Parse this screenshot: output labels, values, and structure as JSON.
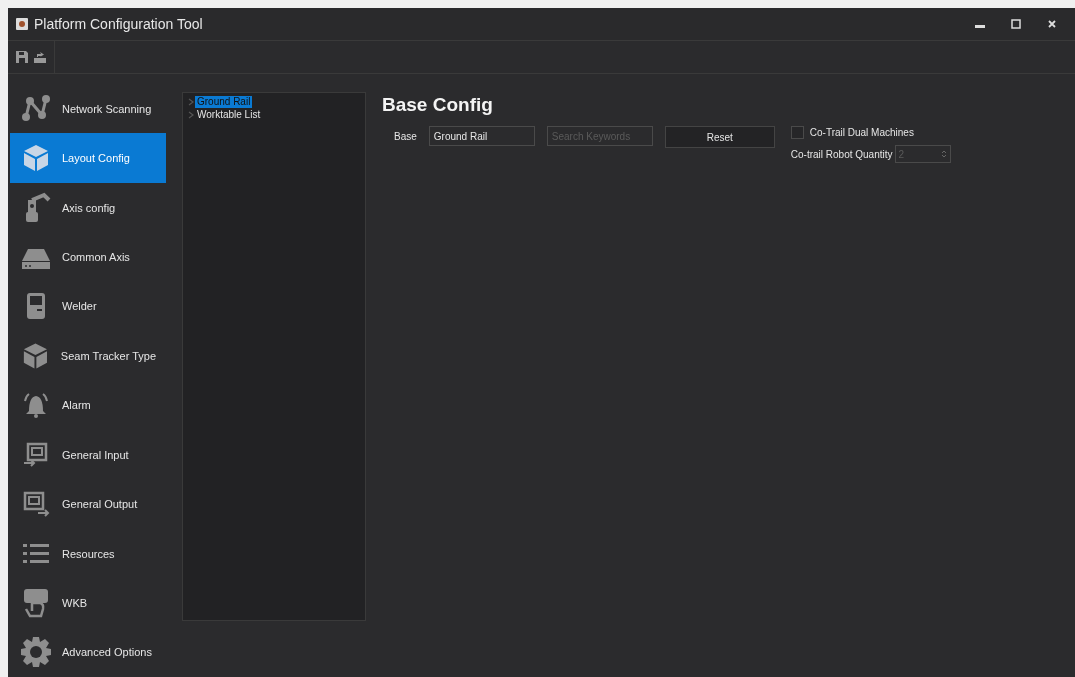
{
  "window": {
    "title": "Platform Configuration Tool"
  },
  "sidebar": {
    "items": [
      {
        "label": "Network Scanning",
        "selected": false
      },
      {
        "label": "Layout Config",
        "selected": true
      },
      {
        "label": "Axis config",
        "selected": false
      },
      {
        "label": "Common Axis",
        "selected": false
      },
      {
        "label": "Welder",
        "selected": false
      },
      {
        "label": "Seam Tracker Type",
        "selected": false
      },
      {
        "label": "Alarm",
        "selected": false
      },
      {
        "label": "General Input",
        "selected": false
      },
      {
        "label": "General Output",
        "selected": false
      },
      {
        "label": "Resources",
        "selected": false
      },
      {
        "label": "WKB",
        "selected": false
      },
      {
        "label": "Advanced Options",
        "selected": false
      }
    ]
  },
  "tree": {
    "items": [
      {
        "label": "Ground Rail",
        "selected": true
      },
      {
        "label": "Worktable List",
        "selected": false
      }
    ]
  },
  "main": {
    "heading": "Base Config",
    "base_label": "Base",
    "base_value": "Ground Rail",
    "search": {
      "placeholder": "Search Keywords"
    },
    "reset_button": "Reset",
    "dual_checkbox": {
      "label": "Co-Trail Dual Machines",
      "checked": false
    },
    "quantity": {
      "label": "Co-trail Robot Quantity",
      "value": "2",
      "disabled": true
    }
  }
}
